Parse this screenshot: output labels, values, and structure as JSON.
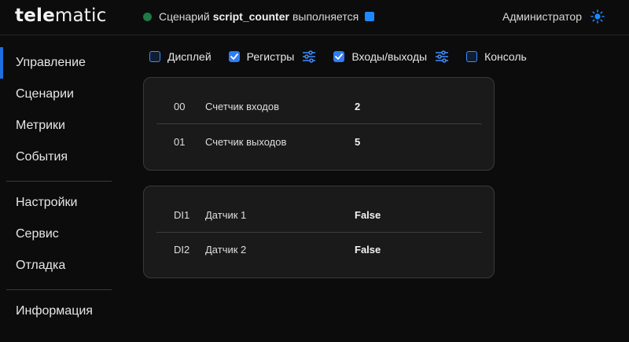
{
  "header": {
    "logo_a": "tele",
    "logo_b": "matic",
    "status_prefix": "Сценарий",
    "script_name": "script_counter",
    "status_suffix": "выполняется",
    "user": "Администратор",
    "colors": {
      "status_dot": "#1f7a45",
      "accent": "#1e88ff"
    }
  },
  "sidebar": {
    "items": [
      {
        "label": "Управление",
        "active": true
      },
      {
        "label": "Сценарии"
      },
      {
        "label": "Метрики"
      },
      {
        "label": "События"
      },
      {
        "label": "Настройки"
      },
      {
        "label": "Сервис"
      },
      {
        "label": "Отладка"
      },
      {
        "label": "Информация"
      }
    ]
  },
  "toolbar": {
    "display": {
      "label": "Дисплей",
      "checked": false
    },
    "registers": {
      "label": "Регистры",
      "checked": true
    },
    "io": {
      "label": "Входы/выходы",
      "checked": true
    },
    "console": {
      "label": "Консоль",
      "checked": false
    }
  },
  "registers": [
    {
      "id": "00",
      "label": "Счетчик входов",
      "value": "2"
    },
    {
      "id": "01",
      "label": "Счетчик выходов",
      "value": "5"
    }
  ],
  "inputs": [
    {
      "id": "DI1",
      "label": "Датчик 1",
      "value": "False"
    },
    {
      "id": "DI2",
      "label": "Датчик 2",
      "value": "False"
    }
  ]
}
